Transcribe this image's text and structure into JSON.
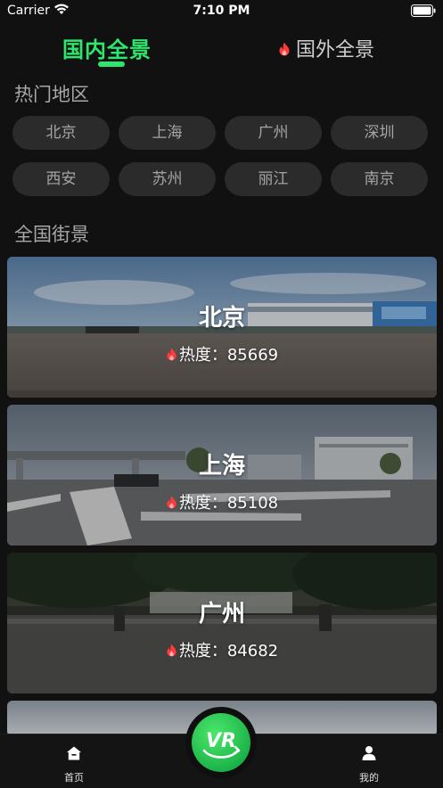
{
  "status": {
    "carrier": "Carrier",
    "time": "7:10 PM"
  },
  "top_tabs": {
    "domestic": "国内全景",
    "foreign": "国外全景",
    "active": "domestic"
  },
  "hot_regions": {
    "title": "热门地区",
    "chips": [
      "北京",
      "上海",
      "广州",
      "深圳",
      "西安",
      "苏州",
      "丽江",
      "南京"
    ]
  },
  "street_view": {
    "title": "全国街景",
    "heat_label": "热度：",
    "cards": [
      {
        "city": "北京",
        "heat": "85669"
      },
      {
        "city": "上海",
        "heat": "85108"
      },
      {
        "city": "广州",
        "heat": "84682"
      }
    ]
  },
  "bottom_tabs": {
    "home": "首页",
    "center_button": "VR",
    "me": "我的"
  },
  "colors": {
    "accent": "#2ee66b",
    "fire": "#ff3b3b",
    "background": "#111111",
    "chip": "#2b2b2b"
  }
}
